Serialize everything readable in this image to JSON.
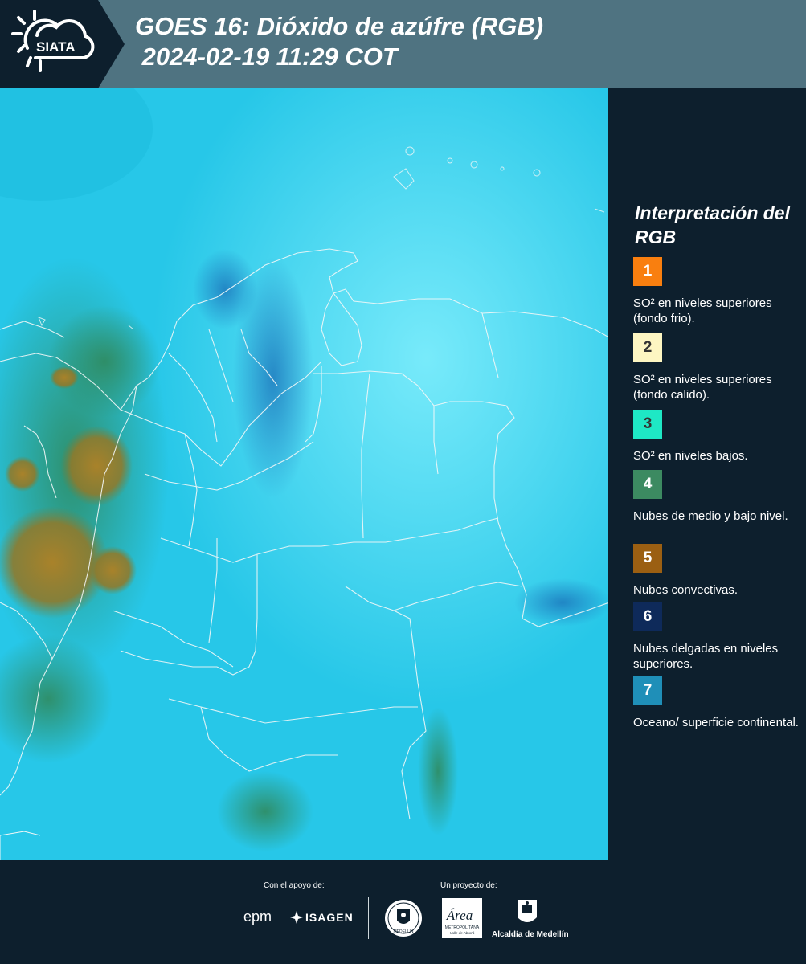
{
  "header": {
    "logo_text": "SIATA",
    "title_line1": "GOES 16: Dióxido de azúfre (RGB)",
    "title_line2": " 2024-02-19 11:29 COT"
  },
  "legend": {
    "title": "Interpretación del RGB",
    "items": [
      {
        "number": "1",
        "label": "SO² en niveles superiores (fondo frio).",
        "color": "#f97f0f",
        "text_color": "#ffffff"
      },
      {
        "number": "2",
        "label": "SO² en niveles superiores (fondo calido).",
        "color": "#fdf6c2",
        "text_color": "#333333"
      },
      {
        "number": "3",
        "label": "SO² en niveles bajos.",
        "color": "#1ee8c5",
        "text_color": "#333333"
      },
      {
        "number": "4",
        "label": "Nubes de medio y bajo nivel.",
        "color": "#3c8a61",
        "text_color": "#ffffff"
      },
      {
        "number": "5",
        "label": "Nubes convectivas.",
        "color": "#9b5f12",
        "text_color": "#ffffff"
      },
      {
        "number": "6",
        "label": "Nubes delgadas en niveles superiores.",
        "color": "#0e2a5a",
        "text_color": "#ffffff"
      },
      {
        "number": "7",
        "label": "Oceano/ superficie continental.",
        "color": "#1f8fb8",
        "text_color": "#ffffff"
      }
    ]
  },
  "footer": {
    "support_label": "Con el apoyo de:",
    "project_label": "Un proyecto de:",
    "epm": "epm",
    "isagen": "ISAGEN",
    "area_name": "Área",
    "area_sub1": "METROPOLITANA",
    "area_sub2": "Valle de Aburrá",
    "alcaldia": "Alcaldía de Medellín",
    "seal_text": "MEDELLÍN"
  }
}
